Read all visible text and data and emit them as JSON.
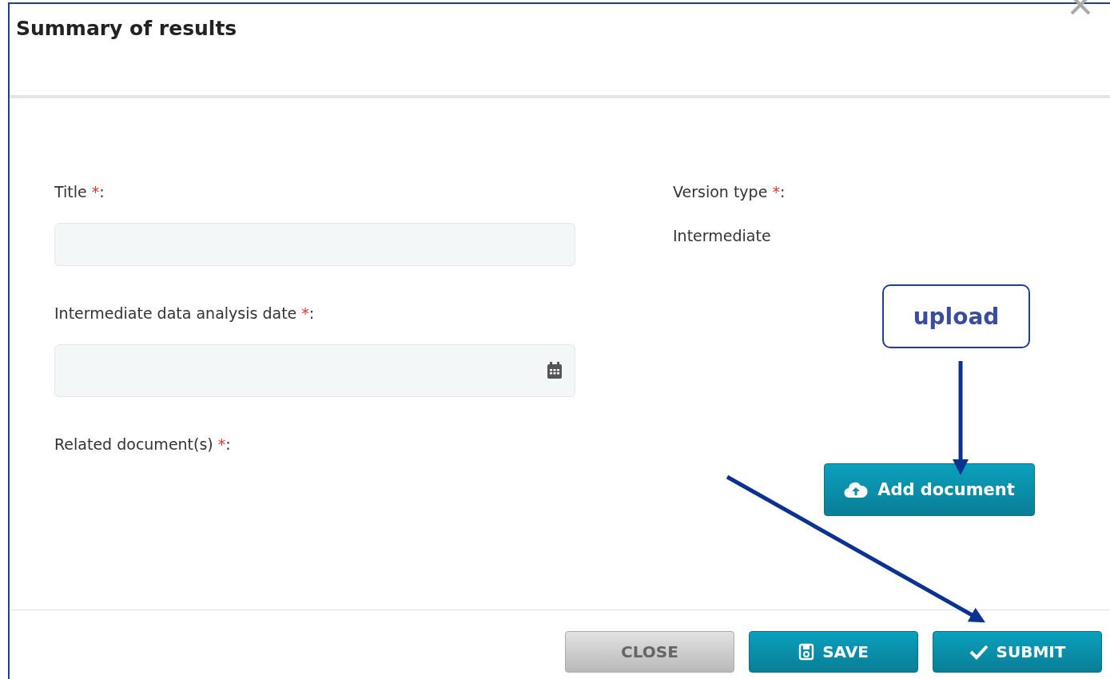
{
  "dialog": {
    "title": "Summary of results"
  },
  "fields": [
    {
      "kind": "text",
      "label": "Title",
      "required_mark": "*",
      "colon": ":"
    },
    {
      "kind": "date",
      "label": "Intermediate data analysis date",
      "required_mark": "*",
      "colon": ":"
    },
    {
      "kind": "upload",
      "label": "Related document(s)",
      "required_mark": "*",
      "colon": ":"
    }
  ],
  "version_type": {
    "label": "Version type",
    "required_mark": "*",
    "colon": ":",
    "value": "Intermediate"
  },
  "add_document_button": "Add document",
  "footer_buttons": [
    {
      "kind": "close",
      "label": "CLOSE"
    },
    {
      "kind": "save",
      "label": "SAVE"
    },
    {
      "kind": "submit",
      "label": "SUBMIT"
    }
  ],
  "annotation": {
    "callout": "upload"
  }
}
